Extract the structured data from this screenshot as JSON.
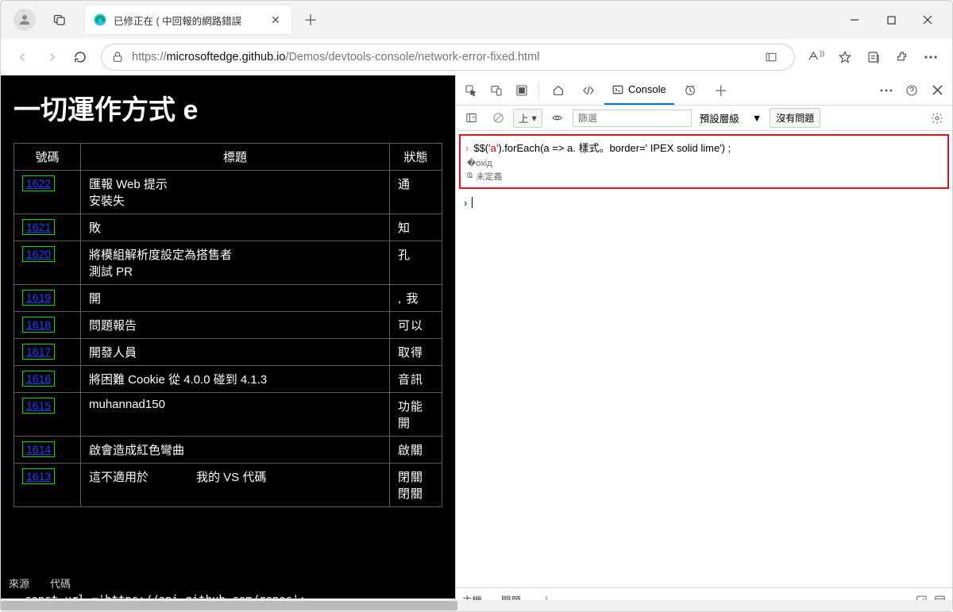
{
  "titlebar": {
    "tab_title": "已修正在 ( 中回報的網路錯誤",
    "new_tab_tooltip": "+"
  },
  "nav": {
    "url_prefix": "https://",
    "url_host": "microsoftedge.github.io",
    "url_path": "/Demos/devtools-console/network-error-fixed.html"
  },
  "page": {
    "heading": "一切運作方式 e",
    "th_number": "號碼",
    "th_title": "標題",
    "th_status": "狀態",
    "rows": [
      {
        "id": "1622",
        "title": "匯報 Web 提示\n安裝失",
        "status": "通"
      },
      {
        "id": "1621",
        "title": "敗",
        "status": "知"
      },
      {
        "id": "1620",
        "title": "將模組解析度設定為搭售者\n測試 PR",
        "status": "孔"
      },
      {
        "id": "1619",
        "title": "開",
        "status": ", 我"
      },
      {
        "id": "1618",
        "title": "問題報告",
        "status": "可以"
      },
      {
        "id": "1617",
        "title": "開發人員",
        "status": "取得"
      },
      {
        "id": "1616",
        "title": "將困難 Cookie 從 4.0.0 碰到 4.1.3",
        "status": "音訊"
      },
      {
        "id": "1615",
        "title": "muhannad150",
        "status": "功能開"
      },
      {
        "id": "1614",
        "title": "啟會造成紅色彎曲",
        "status": "啟關"
      },
      {
        "id": "1613",
        "title": "這不適用於　　　　我的 VS 代碼",
        "status": "閉關閉關"
      }
    ],
    "footer_source": "來源",
    "footer_code_label": "代碼",
    "footer_code": "const url ='https://api.github.com/repos';"
  },
  "devtools": {
    "tabs": {
      "console": "Console"
    },
    "toolbar": {
      "top_label": "上",
      "filter_placeholder": "篩選",
      "level_label": "預設層級",
      "no_issues": "沒有問題"
    },
    "console": {
      "code_prefix": "$$(",
      "code_arg": "'a'",
      "code_mid": ").forEach(a => a. 樣式。border=' IPEX solid lime') ;",
      "undefined_label": "未定義"
    },
    "bottom": {
      "main": "主機",
      "issues": "問題"
    }
  }
}
